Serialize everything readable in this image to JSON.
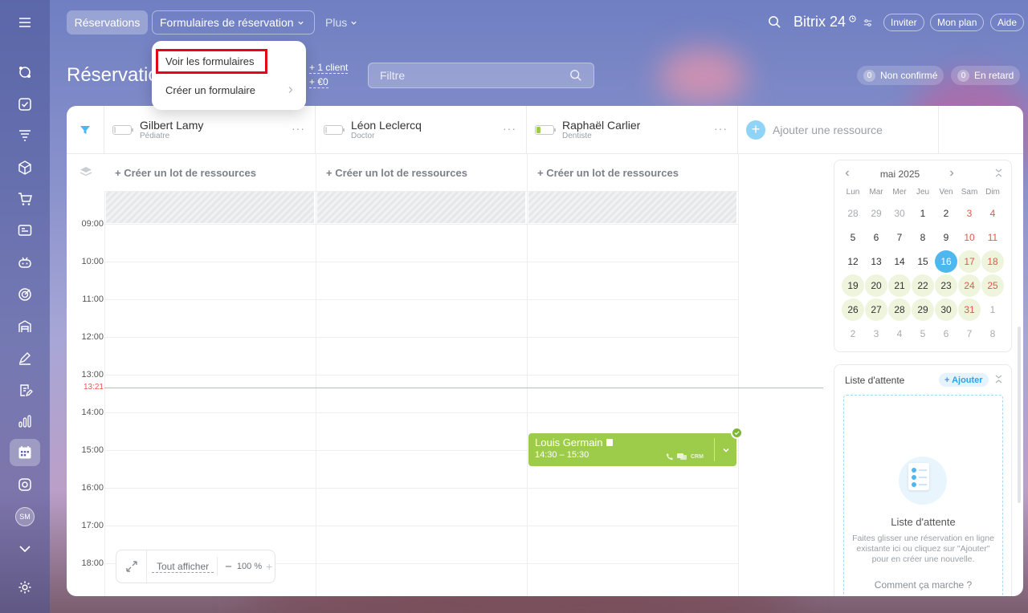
{
  "nav": {
    "reservations_tab": "Réservations",
    "forms_tab": "Formulaires de réservation",
    "more_tab": "Plus",
    "brand_name": "Bitrix 24",
    "invite": "Inviter",
    "my_plan": "Mon plan",
    "help": "Aide"
  },
  "dropdown": {
    "view_forms": "Voir les formulaires",
    "create_form": "Créer un formulaire"
  },
  "page": {
    "title": "Réservations",
    "stat_clients": "+ 1 client",
    "stat_amount": "+ €0",
    "filter_placeholder": "Filtre",
    "unconfirmed_count": "0",
    "unconfirmed_label": "Non confirmé",
    "late_count": "0",
    "late_label": "En retard"
  },
  "resources": [
    {
      "name": "Gilbert Lamy",
      "role": "Pédiatre"
    },
    {
      "name": "Léon Leclercq",
      "role": "Doctor"
    },
    {
      "name": "Raphaël Carlier",
      "role": "Dentiste"
    }
  ],
  "add_resource": "Ajouter une ressource",
  "create_lot": "+ Créer un lot de ressources",
  "hours": [
    "09:00",
    "10:00",
    "11:00",
    "12:00",
    "13:00",
    "14:00",
    "15:00",
    "16:00",
    "17:00",
    "18:00"
  ],
  "current_time": "13:21",
  "booking": {
    "client": "Louis Germain",
    "time": "14:30 – 15:30",
    "crm_label": "CRM"
  },
  "calendar": {
    "month": "mai 2025",
    "weekdays": [
      "Lun",
      "Mar",
      "Mer",
      "Jeu",
      "Ven",
      "Sam",
      "Dim"
    ],
    "weeks": [
      [
        "28",
        "29",
        "30",
        "1",
        "2",
        "3",
        "4"
      ],
      [
        "5",
        "6",
        "7",
        "8",
        "9",
        "10",
        "11"
      ],
      [
        "12",
        "13",
        "14",
        "15",
        "16",
        "17",
        "18"
      ],
      [
        "19",
        "20",
        "21",
        "22",
        "23",
        "24",
        "25"
      ],
      [
        "26",
        "27",
        "28",
        "29",
        "30",
        "31",
        "1"
      ],
      [
        "2",
        "3",
        "4",
        "5",
        "6",
        "7",
        "8"
      ]
    ],
    "today": "16"
  },
  "waitlist": {
    "title": "Liste d'attente",
    "add": "+ Ajouter",
    "empty_title": "Liste d'attente",
    "empty_text": "Faites glisser une réservation en ligne existante ici ou cliquez sur \"Ajouter\" pour en créer une nouvelle.",
    "how_link": "Comment ça marche ?"
  },
  "zoom": {
    "show_all": "Tout afficher",
    "minus": "−",
    "value": "100 %",
    "plus": "+"
  },
  "user_initials": "SM",
  "colors": {
    "booking_green": "#9dcc4a",
    "today_blue": "#4fb7f0",
    "weekend_red": "#e2574c",
    "time_line": "#f2a6a0",
    "highlight_red": "#e30613"
  }
}
